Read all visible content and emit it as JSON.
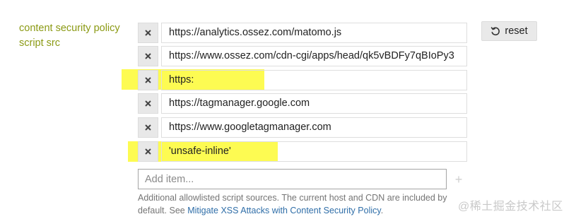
{
  "setting": {
    "label_line1": "content security policy",
    "label_line2": "script src"
  },
  "items": [
    {
      "value": "https://analytics.ossez.com/matomo.js",
      "highlighted": false
    },
    {
      "value": "https://www.ossez.com/cdn-cgi/apps/head/qk5vBDFy7qBIoPy3",
      "highlighted": false
    },
    {
      "value": "https:",
      "highlighted": true
    },
    {
      "value": "https://tagmanager.google.com",
      "highlighted": false
    },
    {
      "value": "https://www.googletagmanager.com",
      "highlighted": false
    },
    {
      "value": "'unsafe-inline'",
      "highlighted": true
    }
  ],
  "remove_icon": "close-icon",
  "reset": {
    "label": "reset",
    "icon": "undo-icon"
  },
  "add": {
    "placeholder": "Add item...",
    "button_label": "+"
  },
  "help": {
    "text": "Additional allowlisted script sources. The current host and CDN are included by default. See ",
    "link_text": "Mitigate XSS Attacks with Content Security Policy",
    "suffix": "."
  },
  "watermark": "@稀土掘金技术社区",
  "colors": {
    "label": "#8b9a14",
    "highlight": "#fdfb52",
    "link": "#2f6ea8"
  }
}
